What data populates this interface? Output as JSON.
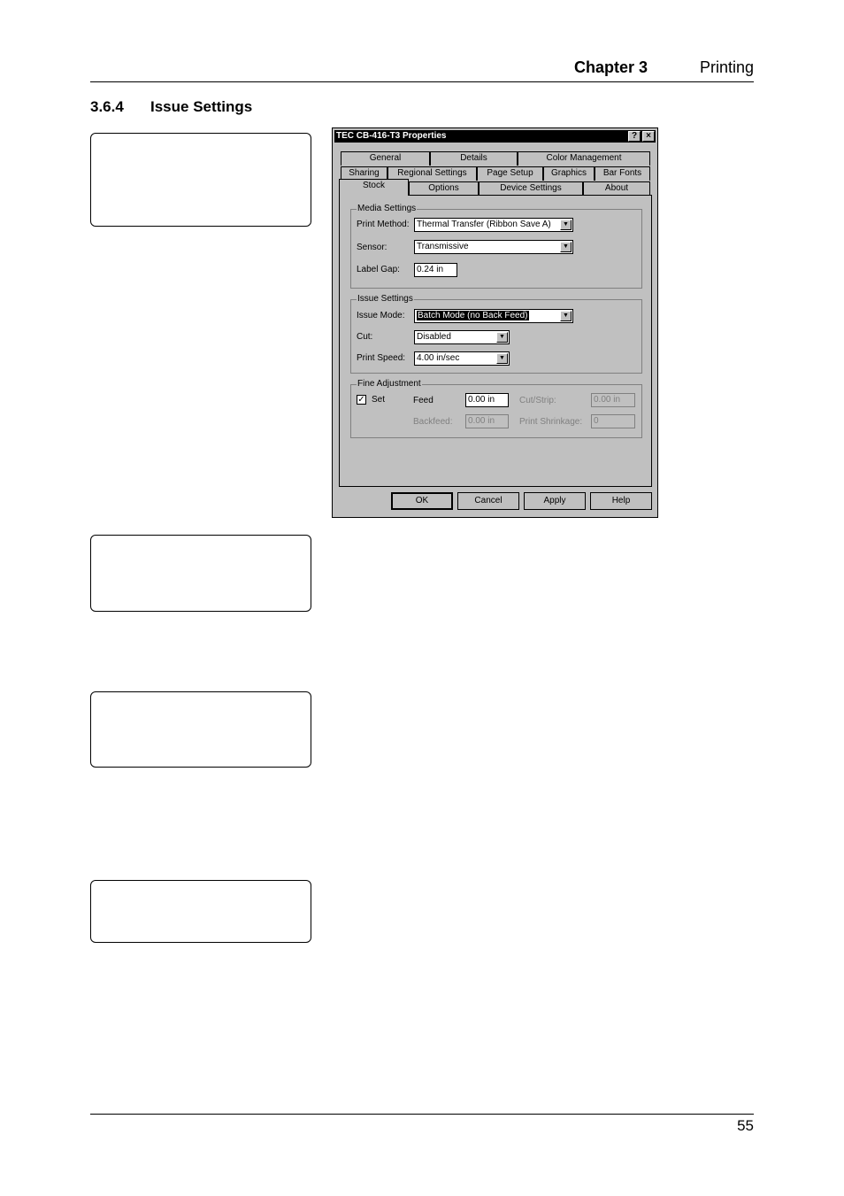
{
  "header": {
    "chapter": "Chapter 3",
    "chapter_title": "Printing"
  },
  "section": {
    "number": "3.6.4",
    "title": "Issue Settings"
  },
  "dialog": {
    "title": "TEC CB-416-T3 Properties",
    "help_button": "?",
    "close_button": "×",
    "tabs_row1": [
      "General",
      "Details",
      "Color Management"
    ],
    "tabs_row2": [
      "Sharing",
      "Regional Settings",
      "Page Setup",
      "Graphics",
      "Bar Fonts"
    ],
    "tabs_row3": [
      "Stock",
      "Options",
      "Device Settings",
      "About"
    ],
    "media_settings": {
      "label": "Media Settings",
      "print_method_label": "Print Method:",
      "print_method_value": "Thermal Transfer (Ribbon Save A)",
      "sensor_label": "Sensor:",
      "sensor_value": "Transmissive",
      "label_gap_label": "Label Gap:",
      "label_gap_value": "0.24 in"
    },
    "issue_settings": {
      "label": "Issue Settings",
      "issue_mode_label": "Issue Mode:",
      "issue_mode_value": "Batch Mode (no Back Feed)",
      "cut_label": "Cut:",
      "cut_value": "Disabled",
      "print_speed_label": "Print Speed:",
      "print_speed_value": "4.00 in/sec"
    },
    "fine_adjustment": {
      "label": "Fine Adjustment",
      "set_label": "Set",
      "set_checked": "✓",
      "feed_label": "Feed",
      "feed_value": "0.00 in",
      "cut_strip_label": "Cut/Strip:",
      "cut_strip_value": "0.00 in",
      "backfeed_label": "Backfeed:",
      "backfeed_value": "0.00 in",
      "print_shrinkage_label": "Print Shrinkage:",
      "print_shrinkage_value": "0"
    },
    "buttons": {
      "ok": "OK",
      "cancel": "Cancel",
      "apply": "Apply",
      "help": "Help"
    }
  },
  "footer": {
    "page_number": "55"
  }
}
